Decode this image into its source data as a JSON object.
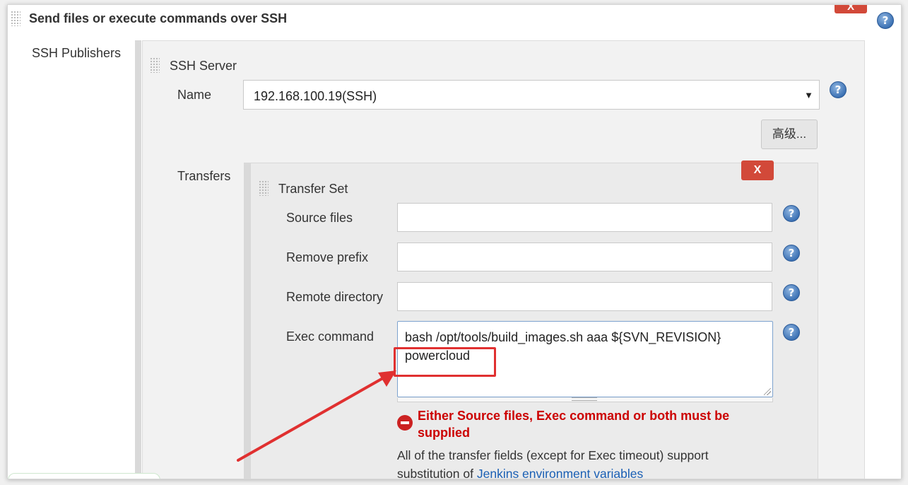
{
  "section": {
    "title": "Send files or execute commands over SSH"
  },
  "ssh_publishers": {
    "label": "SSH Publishers"
  },
  "ssh_server": {
    "title": "SSH Server",
    "name_label": "Name",
    "name_value": "192.168.100.19(SSH)",
    "advanced_button": "高级..."
  },
  "transfers": {
    "label": "Transfers",
    "transfer_set": {
      "title": "Transfer Set",
      "remove_button": "X",
      "source_files_label": "Source files",
      "source_files_value": "",
      "remove_prefix_label": "Remove prefix",
      "remove_prefix_value": "",
      "remote_directory_label": "Remote directory",
      "remote_directory_value": "",
      "exec_command_label": "Exec command",
      "exec_command_lines": [
        "bash /opt/tools/build_images.sh aaa ${SVN_REVISION}",
        "powercloud"
      ],
      "error_message": "Either Source files, Exec command or both must be supplied",
      "info_prefix": "All of the transfer fields (except for Exec timeout) support substitution of ",
      "info_link": "Jenkins environment variables"
    }
  },
  "top_remove_button": "X",
  "help_glyph": "?",
  "dropdown_glyph": "▼",
  "colors": {
    "delete_red": "#d24939",
    "error_red": "#cc0000",
    "annotation_red": "#e03030",
    "help_blue": "#3e73b5",
    "link_blue": "#1a5fb4"
  },
  "icons": [
    "drag-handle-icon",
    "help-icon",
    "error-icon",
    "dropdown-arrow-icon"
  ]
}
